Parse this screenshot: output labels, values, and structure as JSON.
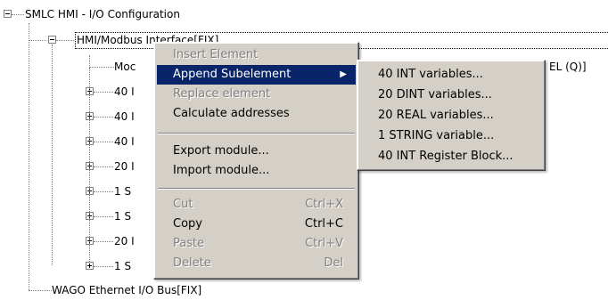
{
  "tree": {
    "root_label": "SMLC HMI - I/O Configuration",
    "hmi_label": "HMI/Modbus Interface[FIX]",
    "child_visible": [
      "Moc",
      "40 I",
      "40 I",
      "40 I",
      "20 I",
      "1 S",
      "1 S",
      "20 I",
      "1 S"
    ],
    "right_fragment": "EL (Q)]",
    "wago_label": "WAGO Ethernet I/O Bus[FIX]"
  },
  "context_menu": {
    "items": [
      {
        "label": "Insert Element",
        "shortcut": "",
        "enabled": false
      },
      {
        "label": "Append Subelement",
        "shortcut": "",
        "enabled": true,
        "submenu": true,
        "highlighted": true
      },
      {
        "label": "Replace element",
        "shortcut": "",
        "enabled": false
      },
      {
        "label": "Calculate addresses",
        "shortcut": "",
        "enabled": true
      },
      {
        "label": "Export module...",
        "shortcut": "",
        "enabled": true
      },
      {
        "label": "Import module...",
        "shortcut": "",
        "enabled": true
      },
      {
        "label": "Cut",
        "shortcut": "Ctrl+X",
        "enabled": false
      },
      {
        "label": "Copy",
        "shortcut": "Ctrl+C",
        "enabled": true
      },
      {
        "label": "Paste",
        "shortcut": "Ctrl+V",
        "enabled": false
      },
      {
        "label": "Delete",
        "shortcut": "Del",
        "enabled": false
      }
    ]
  },
  "submenu": {
    "items": [
      "40 INT variables...",
      "20 DINT variables...",
      "20 REAL variables...",
      "1 STRING variable...",
      "40 INT Register Block..."
    ]
  },
  "colors": {
    "highlight": "#0a246a",
    "menu_bg": "#d4d0c8"
  }
}
